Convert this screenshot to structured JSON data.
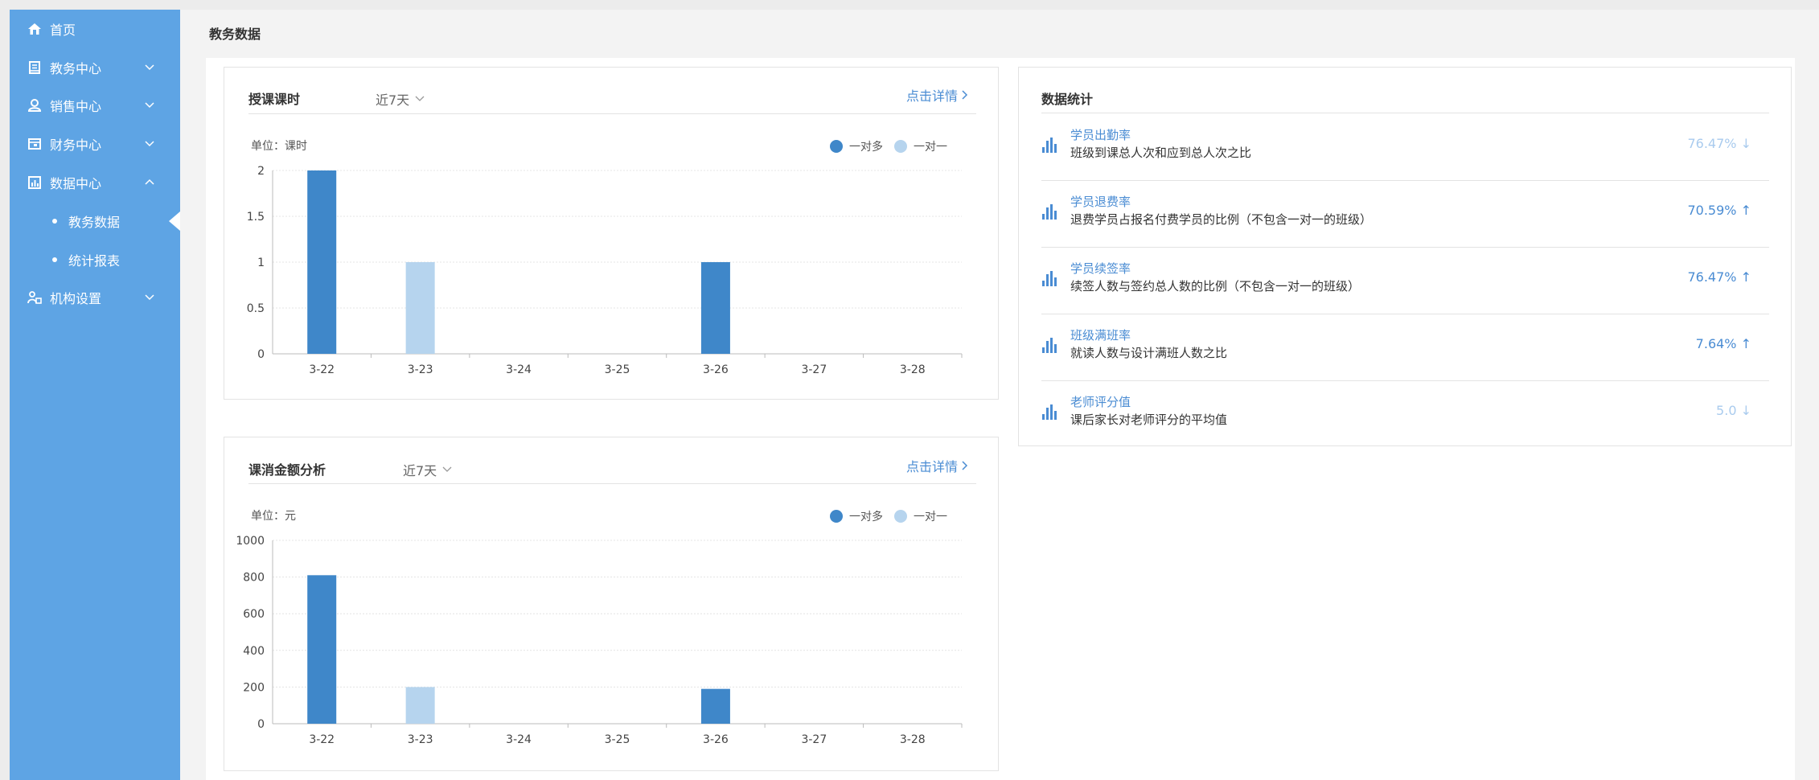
{
  "sidebar": {
    "items": [
      {
        "label": "首页",
        "icon": "home-icon"
      },
      {
        "label": "教务中心",
        "icon": "book-icon"
      },
      {
        "label": "销售中心",
        "icon": "user-icon"
      },
      {
        "label": "财务中心",
        "icon": "wallet-icon"
      },
      {
        "label": "数据中心",
        "icon": "chart-icon"
      },
      {
        "label": "机构设置",
        "icon": "org-icon"
      }
    ],
    "sub_items": [
      {
        "label": "教务数据"
      },
      {
        "label": "统计报表"
      }
    ]
  },
  "header": {
    "title": "教务数据"
  },
  "hours_card": {
    "title": "授课课时",
    "filter": "近7天",
    "link": "点击详情",
    "unit": "单位：课时",
    "legend": [
      "一对多",
      "一对一"
    ]
  },
  "amount_card": {
    "title": "课消金额分析",
    "filter": "近7天",
    "link": "点击详情",
    "unit": "单位：元",
    "legend": [
      "一对多",
      "一对一"
    ]
  },
  "stats_card": {
    "title": "数据统计",
    "rows": [
      {
        "title": "学员出勤率",
        "desc": "班级到课总人次和应到总人次之比",
        "value": "76.47%",
        "trend": "down",
        "muted": true
      },
      {
        "title": "学员退费率",
        "desc": "退费学员占报名付费学员的比例（不包含一对一的班级）",
        "value": "70.59%",
        "trend": "up",
        "muted": false
      },
      {
        "title": "学员续签率",
        "desc": "续签人数与签约总人数的比例（不包含一对一的班级）",
        "value": "76.47%",
        "trend": "up",
        "muted": false
      },
      {
        "title": "班级满班率",
        "desc": "就读人数与设计满班人数之比",
        "value": "7.64%",
        "trend": "up",
        "muted": false
      },
      {
        "title": "老师评分值",
        "desc": "课后家长对老师评分的平均值",
        "value": "5.0",
        "trend": "down",
        "muted": true
      }
    ]
  },
  "colors": {
    "sidebar_bg": "#5ea4e4",
    "one_to_many": "#3f87c9",
    "one_to_one": "#b6d4ee",
    "link": "#4a8cd3",
    "muted_value": "#a9cbee"
  },
  "chart_data": [
    {
      "type": "bar",
      "title": "授课课时",
      "ylabel": "单位：课时",
      "categories": [
        "3-22",
        "3-23",
        "3-24",
        "3-25",
        "3-26",
        "3-27",
        "3-28"
      ],
      "series": [
        {
          "name": "一对多",
          "values": [
            2,
            0,
            0,
            0,
            1,
            0,
            0
          ]
        },
        {
          "name": "一对一",
          "values": [
            0,
            1,
            0,
            0,
            0,
            0,
            0
          ]
        }
      ],
      "yticks": [
        "0",
        "0.5",
        "1",
        "1.5",
        "2"
      ],
      "ylim": [
        0,
        2
      ],
      "grid": true,
      "legend": "top-right"
    },
    {
      "type": "bar",
      "title": "课消金额分析",
      "ylabel": "单位：元",
      "categories": [
        "3-22",
        "3-23",
        "3-24",
        "3-25",
        "3-26",
        "3-27",
        "3-28"
      ],
      "series": [
        {
          "name": "一对多",
          "values": [
            810,
            0,
            0,
            0,
            190,
            0,
            0
          ]
        },
        {
          "name": "一对一",
          "values": [
            0,
            200,
            0,
            0,
            0,
            0,
            0
          ]
        }
      ],
      "yticks": [
        "0",
        "200",
        "400",
        "600",
        "800",
        "1000"
      ],
      "ylim": [
        0,
        1000
      ],
      "grid": true,
      "legend": "top-right"
    }
  ]
}
